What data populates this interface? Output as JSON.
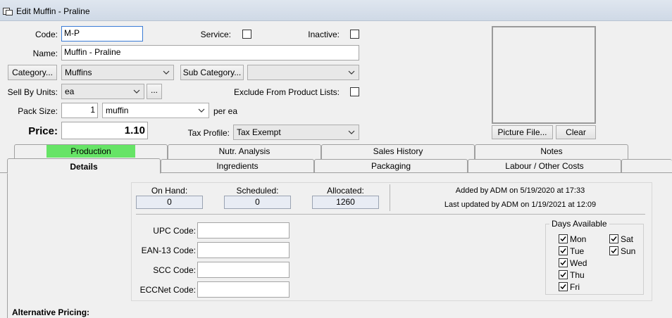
{
  "window": {
    "title": "Edit Muffin - Praline"
  },
  "form": {
    "code_label": "Code:",
    "code_value": "M-P",
    "service_label": "Service:",
    "inactive_label": "Inactive:",
    "name_label": "Name:",
    "name_value": "Muffin - Praline",
    "category_button": "Category...",
    "category_value": "Muffins",
    "subcategory_button": "Sub Category...",
    "subcategory_value": "",
    "sell_by_units_label": "Sell By Units:",
    "sell_by_units_value": "ea",
    "ellipsis_button": "...",
    "exclude_label": "Exclude From Product Lists:",
    "pack_size_label": "Pack Size:",
    "pack_size_value": "1",
    "pack_unit_value": "muffin",
    "per_unit_text": "per ea",
    "price_label": "Price:",
    "price_value": "1.10",
    "tax_profile_label": "Tax Profile:",
    "tax_profile_value": "Tax Exempt",
    "service_checked": false,
    "inactive_checked": false,
    "exclude_checked": false
  },
  "picture": {
    "picture_file_button": "Picture File...",
    "clear_button": "Clear"
  },
  "tabs_back": [
    "Production",
    "Nutr. Analysis",
    "Sales History",
    "Notes"
  ],
  "tabs_front": [
    "Details",
    "Ingredients",
    "Packaging",
    "Labour / Other Costs"
  ],
  "active_tab": "Details",
  "highlight_tab": "Production",
  "highlight_color": "#66e466",
  "details": {
    "on_hand_label": "On Hand:",
    "on_hand_value": "0",
    "scheduled_label": "Scheduled:",
    "scheduled_value": "0",
    "allocated_label": "Allocated:",
    "allocated_value": "1260",
    "added_by_text": "Added by ADM on 5/19/2020 at 17:33",
    "updated_by_text": "Last updated by ADM on 1/19/2021 at 12:09",
    "upc_label": "UPC Code:",
    "upc_value": "",
    "ean_label": "EAN-13 Code:",
    "ean_value": "",
    "scc_label": "SCC Code:",
    "scc_value": "",
    "eccnet_label": "ECCNet Code:",
    "eccnet_value": "",
    "days_title": "Days Available",
    "days": [
      {
        "label": "Mon",
        "checked": true
      },
      {
        "label": "Tue",
        "checked": true
      },
      {
        "label": "Wed",
        "checked": true
      },
      {
        "label": "Thu",
        "checked": true
      },
      {
        "label": "Fri",
        "checked": true
      },
      {
        "label": "Sat",
        "checked": true
      },
      {
        "label": "Sun",
        "checked": true
      }
    ],
    "alt_pricing_label": "Alternative Pricing:"
  }
}
